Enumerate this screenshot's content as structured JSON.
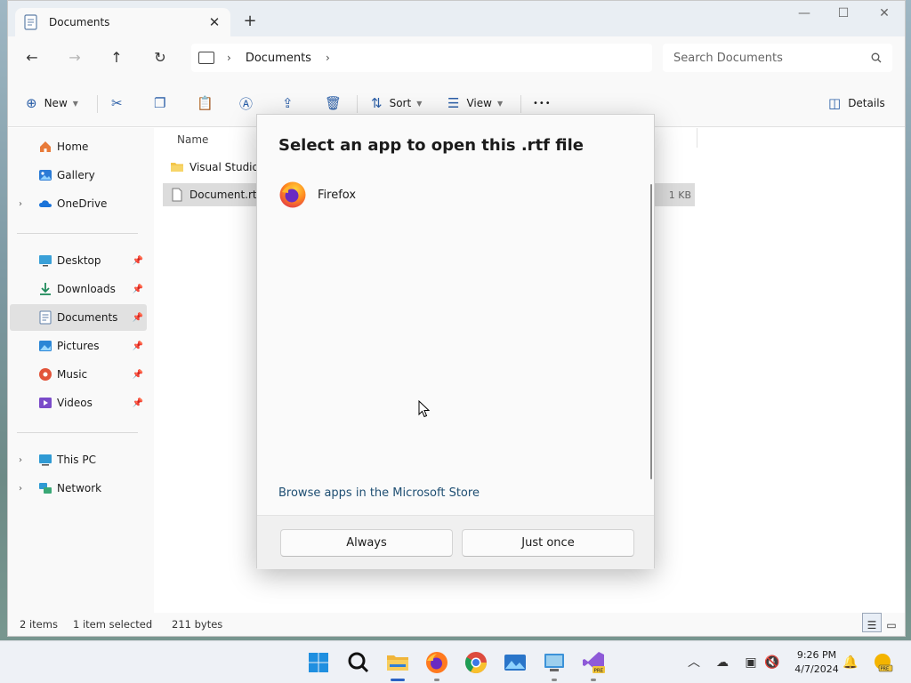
{
  "window": {
    "tab_title": "Documents",
    "close_tab": "✕",
    "new_tab": "+",
    "minimize": "—",
    "maximize": "☐",
    "close": "✕"
  },
  "address": {
    "breadcrumb": "Documents",
    "search_placeholder": "Search Documents"
  },
  "commandbar": {
    "new_label": "New",
    "sort_label": "Sort",
    "view_label": "View",
    "more": "•••",
    "details_label": "Details"
  },
  "sidebar": {
    "items": [
      {
        "label": "Home"
      },
      {
        "label": "Gallery"
      },
      {
        "label": "OneDrive"
      },
      {
        "label": "Desktop"
      },
      {
        "label": "Downloads"
      },
      {
        "label": "Documents"
      },
      {
        "label": "Pictures"
      },
      {
        "label": "Music"
      },
      {
        "label": "Videos"
      },
      {
        "label": "This PC"
      },
      {
        "label": "Network"
      }
    ]
  },
  "filelist": {
    "col_name": "Name",
    "rows": [
      {
        "name": "Visual Studio 20",
        "size": ""
      },
      {
        "name": "Document.rtf",
        "size": "1 KB"
      }
    ]
  },
  "status": {
    "items": "2 items",
    "selected": "1 item selected",
    "size": "211 bytes"
  },
  "dialog": {
    "title": "Select an app to open this .rtf file",
    "app_name": "Firefox",
    "store_link": "Browse apps in the Microsoft Store",
    "always_label": "Always",
    "just_once_label": "Just once"
  },
  "taskbar": {
    "time": "9:26 PM",
    "date": "4/7/2024"
  },
  "colors": {
    "accent": "#2a62c4",
    "folder": "#f3c64a",
    "link": "#1e4e72"
  }
}
